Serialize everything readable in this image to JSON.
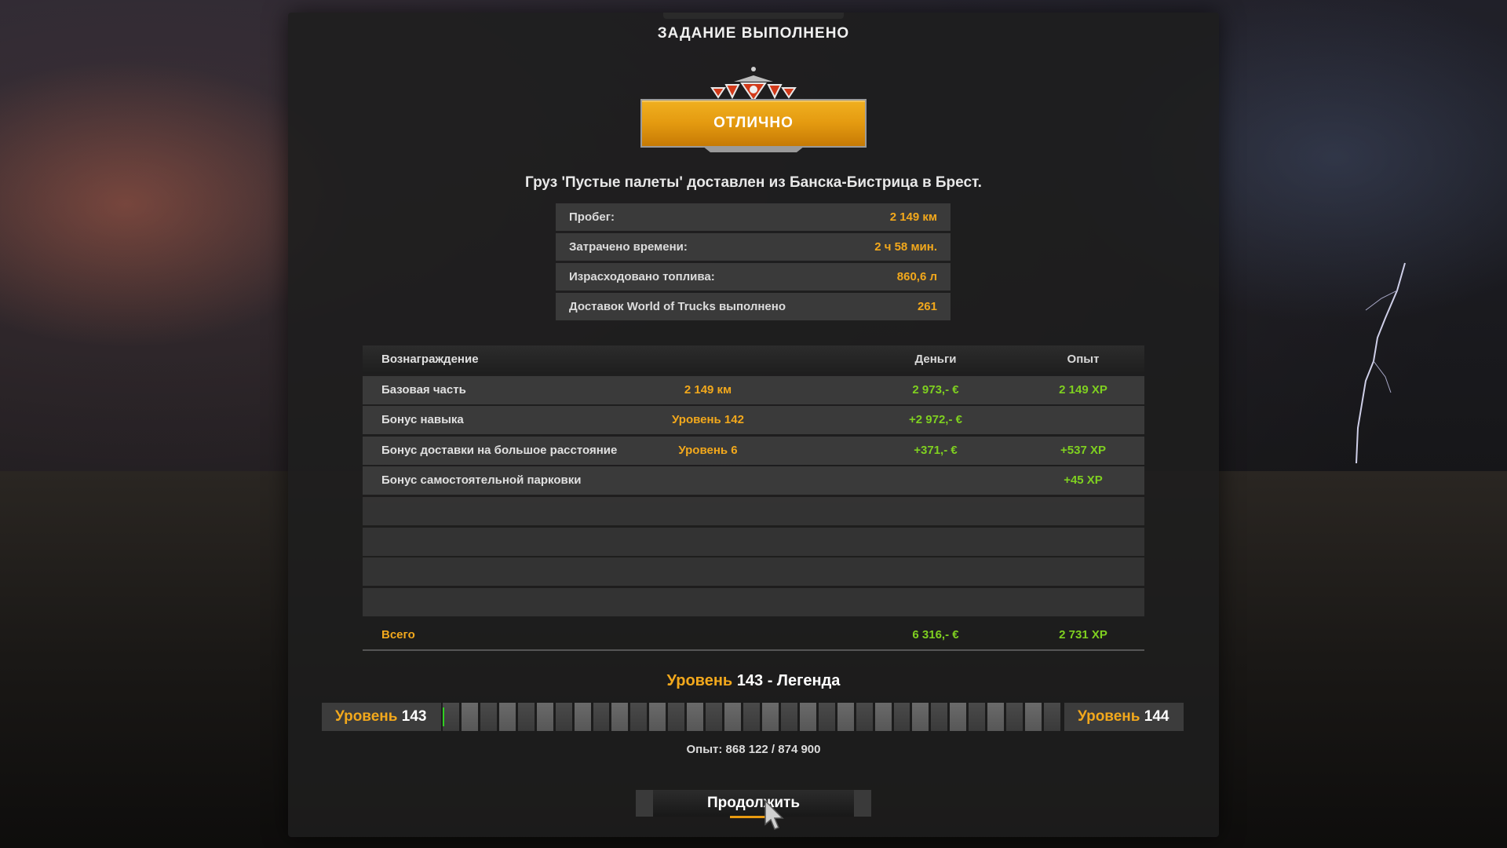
{
  "title": "ЗАДАНИЕ ВЫПОЛНЕНО",
  "rating": "ОТЛИЧНО",
  "delivery_text": "Груз 'Пустые палеты' доставлен из Банска-Бистрица в Брест.",
  "stats": [
    {
      "label": "Пробег:",
      "value": "2 149 км"
    },
    {
      "label": "Затрачено времени:",
      "value": "2 ч 58 мин."
    },
    {
      "label": "Израсходовано топлива:",
      "value": "860,6 л"
    },
    {
      "label": "Доставок World of Trucks выполнено",
      "value": "261"
    }
  ],
  "rewards": {
    "header": {
      "name": "Вознаграждение",
      "money": "Деньги",
      "xp": "Опыт"
    },
    "rows": [
      {
        "name": "Базовая часть",
        "modifier": "2 149 км",
        "money": "2 973,- €",
        "xp": "2 149 XP"
      },
      {
        "name": "Бонус навыка",
        "modifier": "Уровень 142",
        "money": "+2 972,- €",
        "xp": ""
      },
      {
        "name": "Бонус доставки на большое расстояние",
        "modifier": "Уровень 6",
        "money": "+371,- €",
        "xp": "+537 XP"
      },
      {
        "name": "Бонус самостоятельной парковки",
        "modifier": "",
        "money": "",
        "xp": "+45 XP"
      }
    ],
    "total": {
      "name": "Всего",
      "money": "6 316,- €",
      "xp": "2 731 XP"
    }
  },
  "level": {
    "word": "Уровень",
    "current": "143",
    "rank": "- Легенда",
    "next": "144",
    "xp_text": "Опыт: 868 122 / 874 900",
    "progress_fraction": 0.003
  },
  "continue_label": "Продолжить",
  "colors": {
    "accent": "#f2a81c",
    "positive": "#7fd020"
  }
}
